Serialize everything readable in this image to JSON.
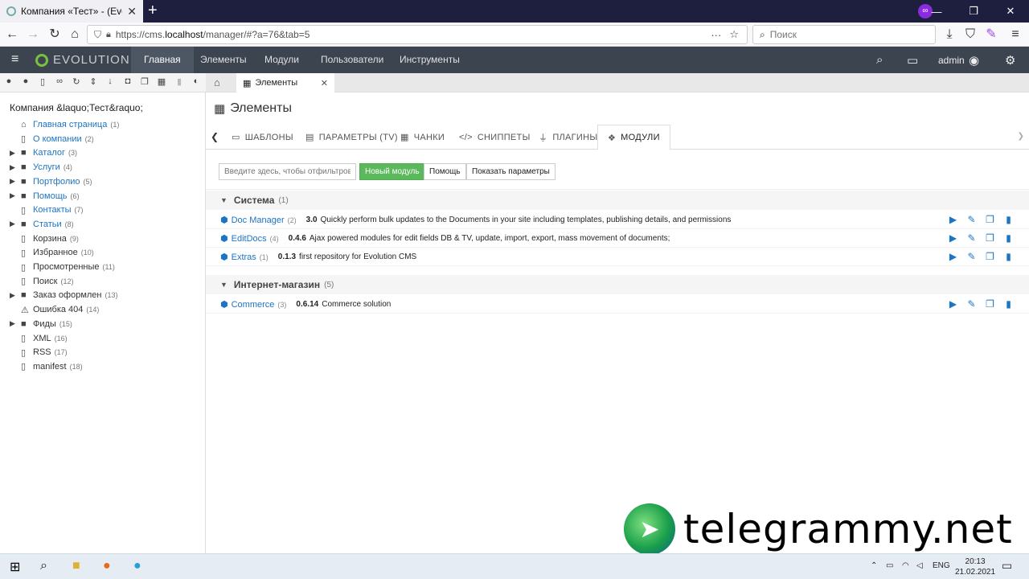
{
  "browser": {
    "tab_title": "Компания «Тест» - (Evolution",
    "url_prefix": "https://cms.",
    "url_host": "localhost",
    "url_path": "/manager/#?a=76&tab=5",
    "search_placeholder": "Поиск"
  },
  "header": {
    "logo": "EVOLUTION",
    "menu": [
      "Главная",
      "Элементы",
      "Модули",
      "Пользователи",
      "Инструменты"
    ],
    "user": "admin"
  },
  "tree": {
    "root": "Компания &laquo;Тест&raquo;",
    "items": [
      {
        "label": "Главная страница",
        "count": "(1)",
        "icon": "home-icon",
        "glyph": "⌂",
        "expand": false,
        "link": true
      },
      {
        "label": "О компании",
        "count": "(2)",
        "icon": "page-icon",
        "glyph": "▯",
        "expand": false,
        "link": true
      },
      {
        "label": "Каталог",
        "count": "(3)",
        "icon": "folder-icon",
        "glyph": "■",
        "expand": true,
        "link": true
      },
      {
        "label": "Услуги",
        "count": "(4)",
        "icon": "folder-icon",
        "glyph": "■",
        "expand": true,
        "link": true
      },
      {
        "label": "Портфолио",
        "count": "(5)",
        "icon": "folder-icon",
        "glyph": "■",
        "expand": true,
        "link": true
      },
      {
        "label": "Помощь",
        "count": "(6)",
        "icon": "folder-icon",
        "glyph": "■",
        "expand": true,
        "link": true
      },
      {
        "label": "Контакты",
        "count": "(7)",
        "icon": "page-icon",
        "glyph": "▯",
        "expand": false,
        "link": true
      },
      {
        "label": "Статьи",
        "count": "(8)",
        "icon": "folder-icon",
        "glyph": "■",
        "expand": true,
        "link": true
      },
      {
        "label": "Корзина",
        "count": "(9)",
        "icon": "page-icon",
        "glyph": "▯",
        "expand": false,
        "link": false
      },
      {
        "label": "Избранное",
        "count": "(10)",
        "icon": "page-icon",
        "glyph": "▯",
        "expand": false,
        "link": false
      },
      {
        "label": "Просмотренные",
        "count": "(11)",
        "icon": "page-icon",
        "glyph": "▯",
        "expand": false,
        "link": false
      },
      {
        "label": "Поиск",
        "count": "(12)",
        "icon": "page-icon",
        "glyph": "▯",
        "expand": false,
        "link": false
      },
      {
        "label": "Заказ оформлен",
        "count": "(13)",
        "icon": "folder-icon",
        "glyph": "■",
        "expand": true,
        "link": false
      },
      {
        "label": "Ошибка 404",
        "count": "(14)",
        "icon": "warning-icon",
        "glyph": "⚠",
        "expand": false,
        "link": false
      },
      {
        "label": "Фиды",
        "count": "(15)",
        "icon": "folder-icon",
        "glyph": "■",
        "expand": true,
        "link": false
      },
      {
        "label": "XML",
        "count": "(16)",
        "icon": "page-icon",
        "glyph": "▯",
        "expand": false,
        "link": false
      },
      {
        "label": "RSS",
        "count": "(17)",
        "icon": "page-icon",
        "glyph": "▯",
        "expand": false,
        "link": false
      },
      {
        "label": "manifest",
        "count": "(18)",
        "icon": "page-icon",
        "glyph": "▯",
        "expand": false,
        "link": false
      }
    ]
  },
  "content_tab": "Элементы",
  "page_title": "Элементы",
  "subtabs": [
    "ШАБЛОНЫ",
    "ПАРАМЕТРЫ (TV)",
    "ЧАНКИ",
    "СНИППЕТЫ",
    "ПЛАГИНЫ",
    "МОДУЛИ"
  ],
  "toolbar": {
    "filter_placeholder": "Введите здесь, чтобы отфильтровать",
    "new_module": "Новый модуль",
    "help": "Помощь",
    "show_params": "Показать параметры"
  },
  "categories": [
    {
      "name": "Система",
      "count": "(1)",
      "modules": [
        {
          "name": "Doc Manager",
          "count": "(2)",
          "version": "3.0",
          "desc": "Quickly perform bulk updates to the Documents in your site including templates, publishing details, and permissions"
        },
        {
          "name": "EditDocs",
          "count": "(4)",
          "version": "0.4.6",
          "desc": "Ajax powered modules for edit fields DB & TV, update, import, export, mass movement of documents;"
        },
        {
          "name": "Extras",
          "count": "(1)",
          "version": "0.1.3",
          "desc": "first repository for Evolution CMS"
        }
      ]
    },
    {
      "name": "Интернет-магазин",
      "count": "(5)",
      "modules": [
        {
          "name": "Commerce",
          "count": "(3)",
          "version": "0.6.14",
          "desc": "Commerce solution"
        }
      ]
    }
  ],
  "watermark": "telegrammy.net",
  "taskbar": {
    "lang": "ENG",
    "time": "20:13",
    "date": "21.02.2021"
  }
}
